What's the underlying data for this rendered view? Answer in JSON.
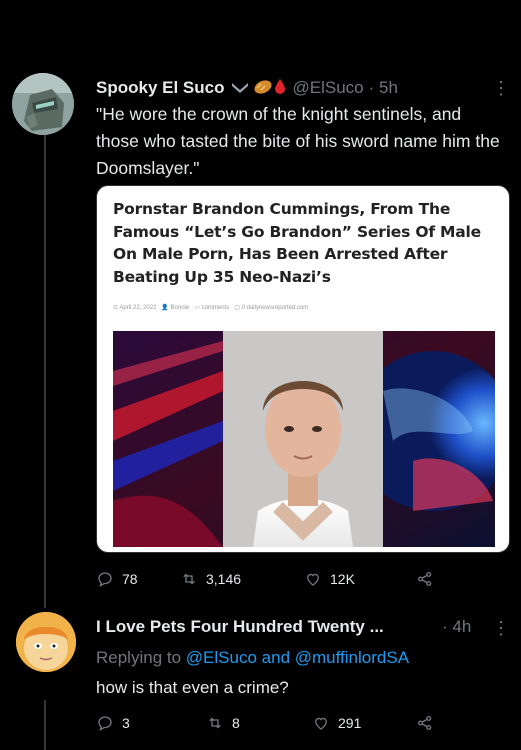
{
  "tweet1": {
    "display_name": "Spooky El Suco",
    "handle": "@ElSuco",
    "time": "· 5h",
    "text": "\"He wore the crown of the knight sentinels, and those who tasted the bite of his sword name him the Doomslayer.\"",
    "card": {
      "title": "Pornstar Brandon Cummings, From The Famous “Let’s Go Brandon” Series Of Male On Male Porn, Has Been Arrested After Beating Up 35 Neo-Nazi’s",
      "meta_date": "April 22, 2022",
      "meta_author": "Bonnie",
      "meta_comments": "comments",
      "meta_source": "dailynewsreported.com"
    },
    "stats": {
      "replies": "78",
      "retweets": "3,146",
      "likes": "12K"
    }
  },
  "tweet2": {
    "display_name": "I Love Pets Four Hundred Twenty ...",
    "time": "· 4h",
    "replying_prefix": "Replying to",
    "mention1": "@ElSuco",
    "and": "and",
    "mention2": "@muffinlordSA",
    "text": "how is that even a crime?",
    "stats": {
      "replies": "3",
      "retweets": "8",
      "likes": "291"
    }
  },
  "colors": {
    "background": "#000000",
    "text": "#e7e9ea",
    "muted": "#71767b",
    "link": "#1d9bf0"
  },
  "icons": [
    "more-icon",
    "reply-icon",
    "retweet-icon",
    "like-icon",
    "share-icon"
  ]
}
